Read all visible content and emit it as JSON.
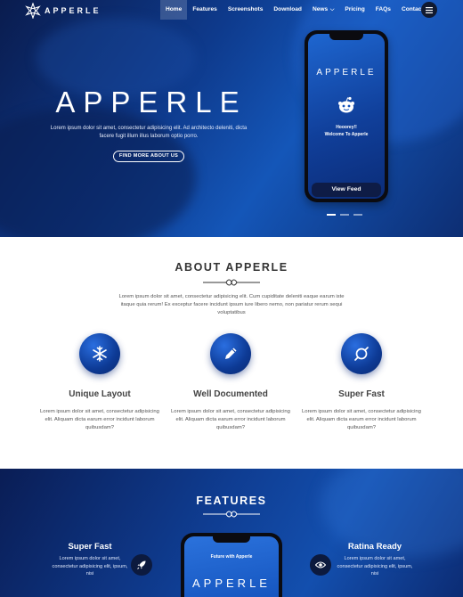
{
  "brand": {
    "name": "APPERLE"
  },
  "nav": {
    "items": [
      {
        "label": "Home",
        "active": true
      },
      {
        "label": "Features"
      },
      {
        "label": "Screenshots"
      },
      {
        "label": "Download"
      },
      {
        "label": "News",
        "has_dropdown": true
      },
      {
        "label": "Pricing"
      },
      {
        "label": "FAQs"
      },
      {
        "label": "Contact"
      }
    ],
    "menu_icon": "hamburger-icon"
  },
  "hero": {
    "title": "APPERLE",
    "text": "Lorem ipsum dolor sit amet, consectetur adipisicing elit. Ad architecto deleniti, dicta facere fugit illum illus laborum optio porro.",
    "button_label": "FIND MORE ABOUT US",
    "phone": {
      "brand": "APPERLE",
      "message_line1": "Hooorey!!",
      "message_line2": "Welcome To Apperle",
      "button_label": "View Feed"
    },
    "slider_dots": 3,
    "active_dot": 0
  },
  "about": {
    "title": "ABOUT APPERLE",
    "text": "Lorem ipsum dolor sit amet, consectetur adipisicing elit. Cum cupiditate deleniti eaque earum iste itaque quia rerum! Ex exceptur facere incidunt ipsum iure libero nemo, non pariatur rerum sequi voluptatibus",
    "features": [
      {
        "icon": "snowflake-icon",
        "title": "Unique Layout",
        "text": "Lorem ipsum dolor sit amet, consectetur adipisicing elit. Aliquam dicta earum error incidunt laborum quibusdam?"
      },
      {
        "icon": "pencil-icon",
        "title": "Well Documented",
        "text": "Lorem ipsum dolor sit amet, consectetur adipisicing elit. Aliquam dicta earum error incidunt laborum quibusdam?"
      },
      {
        "icon": "orbit-icon",
        "title": "Super Fast",
        "text": "Lorem ipsum dolor sit amet, consectetur adipisicing elit. Aliquam dicta earum error incidunt laborum quibusdam?"
      }
    ]
  },
  "features": {
    "title": "FEATURES",
    "left": {
      "title": "Super Fast",
      "text": "Lorem ipsum dolor sit amet, consectetur adipisicing elit, ipsum, nisi",
      "icon": "rocket-icon"
    },
    "right": {
      "title": "Ratina Ready",
      "text": "Lorem ipsum dolor sit amet, consectetur adipisicing elit, ipsum, nisi",
      "icon": "eye-icon"
    },
    "phone": {
      "caption": "Future with Apperle",
      "brand": "APPERLE"
    }
  },
  "colors": {
    "primary": "#0e3a8c",
    "accent": "#1456b8",
    "dark": "#0a1c4e"
  }
}
